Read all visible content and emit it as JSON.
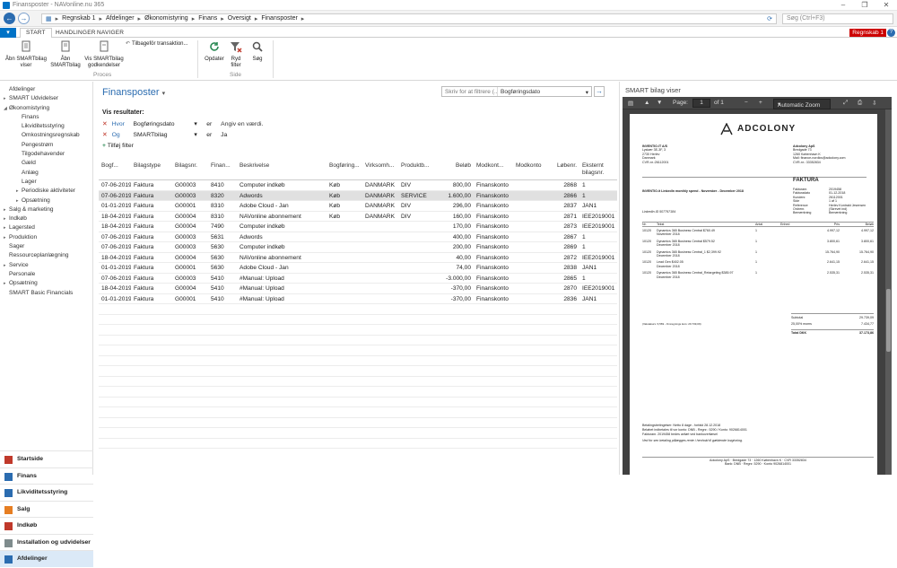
{
  "window": {
    "title": "Finansposter - NAVonline.nu 365",
    "controls": [
      "–",
      "❐",
      "✕"
    ]
  },
  "address": {
    "crumbs": [
      "Regnskab 1",
      "Afdelinger",
      "Økonomistyring",
      "Finans",
      "Oversigt",
      "Finansposter"
    ],
    "search_placeholder": "Søg (Ctrl+F3)"
  },
  "ribbon_tabs": [
    "START",
    "HANDLINGER",
    "NAVIGER"
  ],
  "company_badge": "Regnskab 1",
  "ribbon": {
    "b1": "Åbn SMARTbilag viser",
    "b2": "Åbn SMARTbilag",
    "b3": "Vis SMARTbilag godkendelser",
    "b4": "Tilbageför transaktion...",
    "b5": "Opdater",
    "b6": "Ryd filter",
    "b7": "Søg",
    "g1": "Proces",
    "g2": "Side"
  },
  "nav": {
    "tree": [
      {
        "label": "Afdelinger",
        "indent": 0,
        "arrow": ""
      },
      {
        "label": "SMART Udvidelser",
        "indent": 0,
        "arrow": "▸"
      },
      {
        "label": "Økonomistyring",
        "indent": 0,
        "arrow": "◢"
      },
      {
        "label": "Finans",
        "indent": 1,
        "arrow": ""
      },
      {
        "label": "Likviditetsstyring",
        "indent": 1,
        "arrow": ""
      },
      {
        "label": "Omkostningsregnskab",
        "indent": 1,
        "arrow": ""
      },
      {
        "label": "Pengestrøm",
        "indent": 1,
        "arrow": ""
      },
      {
        "label": "Tilgodehavender",
        "indent": 1,
        "arrow": ""
      },
      {
        "label": "Gæld",
        "indent": 1,
        "arrow": ""
      },
      {
        "label": "Anlæg",
        "indent": 1,
        "arrow": ""
      },
      {
        "label": "Lager",
        "indent": 1,
        "arrow": ""
      },
      {
        "label": "Periodiske aktiviteter",
        "indent": 1,
        "arrow": "▸"
      },
      {
        "label": "Opsætning",
        "indent": 1,
        "arrow": "▸"
      },
      {
        "label": "Salg & marketing",
        "indent": 0,
        "arrow": "▸"
      },
      {
        "label": "Indkøb",
        "indent": 0,
        "arrow": "▸"
      },
      {
        "label": "Lagersted",
        "indent": 0,
        "arrow": "▸"
      },
      {
        "label": "Produktion",
        "indent": 0,
        "arrow": "▸"
      },
      {
        "label": "Sager",
        "indent": 0,
        "arrow": ""
      },
      {
        "label": "Ressourceplanlægning",
        "indent": 0,
        "arrow": ""
      },
      {
        "label": "Service",
        "indent": 0,
        "arrow": "▸"
      },
      {
        "label": "Personale",
        "indent": 0,
        "arrow": ""
      },
      {
        "label": "Opsætning",
        "indent": 0,
        "arrow": "▸"
      },
      {
        "label": "SMART Basic Financials",
        "indent": 0,
        "arrow": ""
      }
    ],
    "bottom": [
      "Startside",
      "Finans",
      "Likviditetsstyring",
      "Salg",
      "Indkøb",
      "Installation og udvidelser",
      "Afdelinger"
    ],
    "bottom_colors": [
      "#c0392b",
      "#2b6cb0",
      "#2b6cb0",
      "#e67e22",
      "#c0392b",
      "#7f8c8d",
      "#2b6cb0"
    ]
  },
  "page": {
    "title": "Finansposter",
    "filter_left": "Skriv for at filtrere (...",
    "filter_right": "Bogføringsdato",
    "show_results": "Vis resultater:",
    "f1": {
      "kw": "Hvor",
      "field": "Bogføringsdato",
      "op": "er",
      "val": "Angiv en værdi."
    },
    "f2": {
      "kw": "Og",
      "field": "SMARTbilag",
      "op": "er",
      "val": "Ja"
    },
    "add_filter": "Tilføj filter"
  },
  "table": {
    "headers": [
      "Bogf...",
      "Bilagstype",
      "Bilagsnr.",
      "Finan...",
      "Beskrivelse",
      "Bogføring...",
      "Virksomh...",
      "Produktb...",
      "Beløb",
      "Modkont...",
      "Modkonto",
      "Løbenr.",
      "Eksternt bilagsnr."
    ],
    "rows": [
      [
        "07-06-2019",
        "Faktura",
        "G00003",
        "8410",
        "Computer indkøb",
        "Køb",
        "DANMARK",
        "DIV",
        "800,00",
        "Finanskonto",
        "",
        "2868",
        "1"
      ],
      [
        "07-06-2019",
        "Faktura",
        "G00003",
        "8320",
        "Adwords",
        "Køb",
        "DANMARK",
        "SERVICE",
        "1.600,00",
        "Finanskonto",
        "",
        "2866",
        "1"
      ],
      [
        "01-01-2019",
        "Faktura",
        "G00001",
        "8310",
        "Adobe Cloud - Jan",
        "Køb",
        "DANMARK",
        "DIV",
        "296,00",
        "Finanskonto",
        "",
        "2837",
        "JAN1"
      ],
      [
        "18-04-2019",
        "Faktura",
        "G00004",
        "8310",
        "NAVonline abonnement",
        "Køb",
        "DANMARK",
        "DIV",
        "160,00",
        "Finanskonto",
        "",
        "2871",
        "IEE2019001"
      ],
      [
        "18-04-2019",
        "Faktura",
        "G00004",
        "7490",
        "Computer indkøb",
        "",
        "",
        "",
        "170,00",
        "Finanskonto",
        "",
        "2873",
        "IEE2019001"
      ],
      [
        "07-06-2019",
        "Faktura",
        "G00003",
        "5631",
        "Adwords",
        "",
        "",
        "",
        "400,00",
        "Finanskonto",
        "",
        "2867",
        "1"
      ],
      [
        "07-06-2019",
        "Faktura",
        "G00003",
        "5630",
        "Computer indkøb",
        "",
        "",
        "",
        "200,00",
        "Finanskonto",
        "",
        "2869",
        "1"
      ],
      [
        "18-04-2019",
        "Faktura",
        "G00004",
        "5630",
        "NAVonline abonnement",
        "",
        "",
        "",
        "40,00",
        "Finanskonto",
        "",
        "2872",
        "IEE2019001"
      ],
      [
        "01-01-2019",
        "Faktura",
        "G00001",
        "5630",
        "Adobe Cloud - Jan",
        "",
        "",
        "",
        "74,00",
        "Finanskonto",
        "",
        "2838",
        "JAN1"
      ],
      [
        "07-06-2019",
        "Faktura",
        "G00003",
        "5410",
        "#Manual: Upload",
        "",
        "",
        "",
        "-3.000,00",
        "Finanskonto",
        "",
        "2865",
        "1"
      ],
      [
        "18-04-2019",
        "Faktura",
        "G00004",
        "5410",
        "#Manual: Upload",
        "",
        "",
        "",
        "-370,00",
        "Finanskonto",
        "",
        "2870",
        "IEE2019001"
      ],
      [
        "01-01-2019",
        "Faktura",
        "G00001",
        "5410",
        "#Manual: Upload",
        "",
        "",
        "",
        "-370,00",
        "Finanskonto",
        "",
        "2836",
        "JAN1"
      ]
    ],
    "highlight_row": 1,
    "empty_rows": 14
  },
  "viewer": {
    "pane_title": "SMART bilag viser",
    "page_label": "Page:",
    "page_value": "1",
    "page_of": "of 1",
    "zoom": "Automatic Zoom",
    "logo": "ADCOLONY",
    "sender": [
      "INVENTIO.IT A/S",
      "Lyskær 3E-3F, 3",
      "2730 Herlev",
      "Danmark",
      "",
      "CVR-nr.:26112001"
    ],
    "recipient": [
      "Adcolony ApS",
      "Bredgade 73",
      "1260 København K",
      "Mail: finance-nordics@adcolony.com",
      "",
      "CVR-nr.: 33352834"
    ],
    "heading": "FAKTURA",
    "meta": [
      [
        "Fakturanr.",
        "2019458"
      ],
      [
        "Fakturadato",
        "01-12-2018"
      ],
      [
        "Kundenr.",
        "26112001"
      ],
      [
        "Side",
        "1 af 1"
      ],
      [
        "Reference",
        "Herlev Kontrakt Jesensen"
      ],
      [
        "Ordrenr.",
        "(Skrevet ind)"
      ],
      [
        "Bemærkning",
        "Bemærkning"
      ]
    ],
    "invoice_title": "INVENTIO.it LinkedIn monthly spend - November - December 2018",
    "linkedin_id": "LinkedIn ID 507797184",
    "cols": [
      "Nr.",
      "Tekst",
      "Antal",
      "Enhed",
      "Pris",
      "Beløb"
    ],
    "lines": [
      [
        "10120",
        "Dynamics 365 Business Central $760.49",
        "1",
        "4.997,12",
        "4.997,12"
      ],
      [
        "",
        "November 2018",
        "",
        "",
        ""
      ],
      [
        "10120",
        "Dynamics 365 Business Central $579.52",
        "1",
        "3.800,61",
        "3.800,61"
      ],
      [
        "",
        "December 2018",
        "",
        "",
        ""
      ],
      [
        "10120",
        "Dynamics 365 Business Central_1 $2,399.92",
        "1",
        "15.764,90",
        "15.764,90"
      ],
      [
        "",
        "December 2018",
        "",
        "",
        ""
      ],
      [
        "10120",
        "Lead Gen $402.05",
        "1",
        "2.641,15",
        "2.641,15"
      ],
      [
        "",
        "December 2018",
        "",
        "",
        ""
      ],
      [
        "10120",
        "Dynamics 365 Business Central_Retargeting $385.97",
        "1",
        "2.535,31",
        "2.535,31"
      ],
      [
        "",
        "December 2018",
        "",
        "",
        ""
      ]
    ],
    "subtotal_label": "Subtotal",
    "subtotal": "29.739,09",
    "vat_label": "25,00% moms",
    "vat": "7.434,77",
    "total_label": "Total DKK",
    "total": "37.173,86",
    "small_note": "(Valutakurs: 6,569 - Omregnings kurs: 29.739,09)",
    "terms": [
      "Betalingsbetingelser: Netto 8 dage - forfald 28.12.2018",
      "Beløbet indbetales til vor konto: DNB - Regnr.: 5290 / Konto: 9026814001",
      "Fakturanr. 2019458 bedes anført ved bankoverførsel"
    ],
    "reminder": "Ved for sen betaling pålægges rente i henhold til gældende lovgivning.",
    "footer": [
      "Adcolony ApS · Bredgade 73 · 1260 København K · CVR 33352834",
      "Bank: DNB · Regnr. 5290 · Konto 9026814001"
    ]
  }
}
